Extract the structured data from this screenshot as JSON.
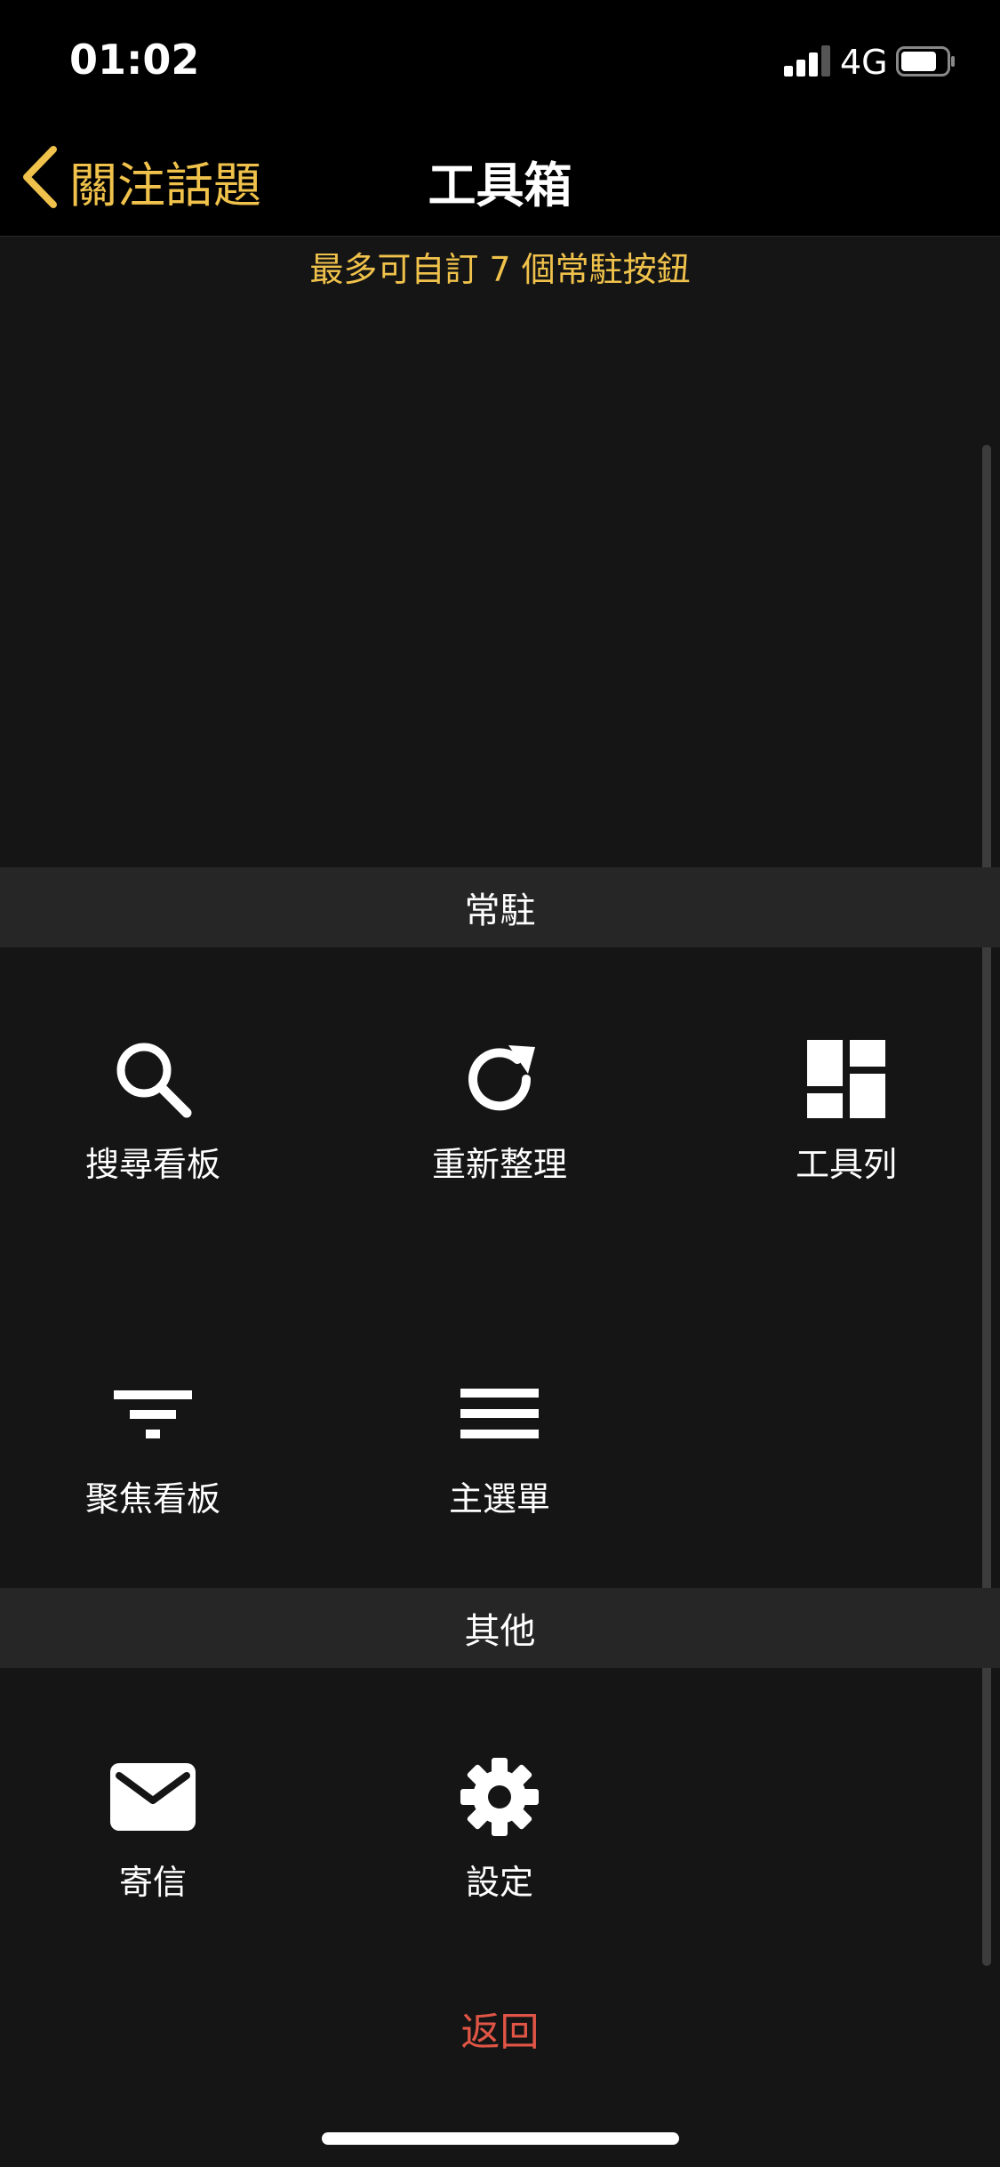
{
  "status": {
    "time": "01:02",
    "network": "4G",
    "battery_level": 0.8
  },
  "nav": {
    "back_label": "關注話題",
    "title": "工具箱"
  },
  "hint": "最多可自訂 7 個常駐按鈕",
  "sections": {
    "pinned": {
      "title": "常駐",
      "items": [
        {
          "label": "搜尋看板",
          "icon": "search-icon"
        },
        {
          "label": "重新整理",
          "icon": "refresh-icon"
        },
        {
          "label": "工具列",
          "icon": "toolbar-grid-icon"
        },
        {
          "label": "聚焦看板",
          "icon": "filter-icon"
        },
        {
          "label": "主選單",
          "icon": "menu-icon"
        }
      ]
    },
    "others": {
      "title": "其他",
      "items": [
        {
          "label": "寄信",
          "icon": "mail-icon"
        },
        {
          "label": "設定",
          "icon": "gear-icon"
        }
      ]
    }
  },
  "return_label": "返回",
  "colors": {
    "accent": "#f0c24b",
    "danger": "#e05545",
    "background": "#151515",
    "section": "#262626"
  }
}
